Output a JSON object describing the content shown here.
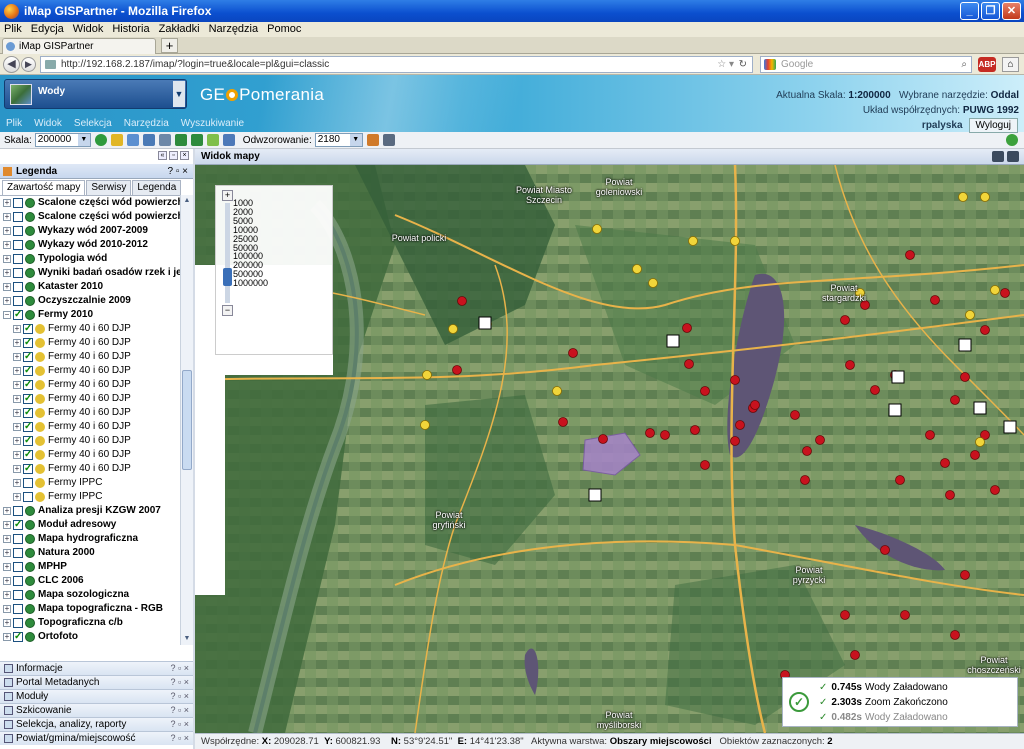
{
  "browser": {
    "title": "iMap GISPartner - Mozilla Firefox",
    "menu": [
      "Plik",
      "Edycja",
      "Widok",
      "Historia",
      "Zakładki",
      "Narzędzia",
      "Pomoc"
    ],
    "tab_title": "iMap GISPartner",
    "new_tab": "+",
    "url": "http://192.168.2.187/imap/?login=true&locale=pl&gui=classic",
    "search_placeholder": "Google",
    "addon_label": "ABP"
  },
  "app": {
    "active_layer": "Wody",
    "logo_pre": "GE",
    "logo_post": "Pomerania",
    "menu": [
      "Plik",
      "Widok",
      "Selekcja",
      "Narzędzia",
      "Wyszukiwanie"
    ],
    "scale_label": "Aktualna Skala:",
    "scale_value": "1:200000",
    "tool_label": "Wybrane narzędzie:",
    "tool_value": "Oddal",
    "crs_label": "Układ współrzędnych:",
    "crs_value": "PUWG 1992",
    "user": "rpalyska",
    "logout": "Wyloguj"
  },
  "toolbar": {
    "scale_label": "Skala:",
    "scale_value": "200000",
    "refresh_label": "Odwzorowanie:",
    "refresh_value": "2180"
  },
  "legend": {
    "title": "Legenda",
    "tabs": [
      "Zawartość mapy",
      "Serwisy",
      "Legenda"
    ],
    "items": [
      {
        "label": "Scalone części wód powierzchn",
        "lvl": 0,
        "bold": true,
        "checked": false,
        "exp": "+"
      },
      {
        "label": "Scalone części wód powierzchn",
        "lvl": 0,
        "bold": true,
        "checked": false,
        "exp": "+"
      },
      {
        "label": "Wykazy wód 2007-2009",
        "lvl": 0,
        "bold": true,
        "checked": false,
        "exp": "+"
      },
      {
        "label": "Wykazy wód 2010-2012",
        "lvl": 0,
        "bold": true,
        "checked": false,
        "exp": "+"
      },
      {
        "label": "Typologia wód",
        "lvl": 0,
        "bold": true,
        "checked": false,
        "exp": "+"
      },
      {
        "label": "Wyniki badań osadów rzek i jez",
        "lvl": 0,
        "bold": true,
        "checked": false,
        "exp": "+"
      },
      {
        "label": "Kataster 2010",
        "lvl": 0,
        "bold": true,
        "checked": false,
        "exp": "+"
      },
      {
        "label": "Oczyszczalnie 2009",
        "lvl": 0,
        "bold": true,
        "checked": false,
        "exp": "+"
      },
      {
        "label": "Fermy 2010",
        "lvl": 0,
        "bold": true,
        "checked": true,
        "exp": "−"
      },
      {
        "label": "Fermy 40 i 60 DJP",
        "lvl": 1,
        "bold": false,
        "checked": true,
        "exp": "+"
      },
      {
        "label": "Fermy 40 i 60 DJP",
        "lvl": 1,
        "bold": false,
        "checked": true,
        "exp": "+"
      },
      {
        "label": "Fermy 40 i 60 DJP",
        "lvl": 1,
        "bold": false,
        "checked": true,
        "exp": "+"
      },
      {
        "label": "Fermy 40 i 60 DJP",
        "lvl": 1,
        "bold": false,
        "checked": true,
        "exp": "+"
      },
      {
        "label": "Fermy 40 i 60 DJP",
        "lvl": 1,
        "bold": false,
        "checked": true,
        "exp": "+"
      },
      {
        "label": "Fermy 40 i 60 DJP",
        "lvl": 1,
        "bold": false,
        "checked": true,
        "exp": "+"
      },
      {
        "label": "Fermy 40 i 60 DJP",
        "lvl": 1,
        "bold": false,
        "checked": true,
        "exp": "+"
      },
      {
        "label": "Fermy 40 i 60 DJP",
        "lvl": 1,
        "bold": false,
        "checked": true,
        "exp": "+"
      },
      {
        "label": "Fermy 40 i 60 DJP",
        "lvl": 1,
        "bold": false,
        "checked": true,
        "exp": "+"
      },
      {
        "label": "Fermy 40 i 60 DJP",
        "lvl": 1,
        "bold": false,
        "checked": true,
        "exp": "+"
      },
      {
        "label": "Fermy 40 i 60 DJP",
        "lvl": 1,
        "bold": false,
        "checked": true,
        "exp": "+"
      },
      {
        "label": "Fermy IPPC",
        "lvl": 1,
        "bold": false,
        "checked": false,
        "exp": "+"
      },
      {
        "label": "Fermy IPPC",
        "lvl": 1,
        "bold": false,
        "checked": false,
        "exp": "+"
      },
      {
        "label": "Analiza presji KZGW 2007",
        "lvl": 0,
        "bold": true,
        "checked": false,
        "exp": "+"
      },
      {
        "label": "Moduł adresowy",
        "lvl": 0,
        "bold": true,
        "checked": true,
        "exp": "+"
      },
      {
        "label": "Mapa hydrograficzna",
        "lvl": 0,
        "bold": true,
        "checked": false,
        "exp": "+"
      },
      {
        "label": "Natura 2000",
        "lvl": 0,
        "bold": true,
        "checked": false,
        "exp": "+"
      },
      {
        "label": "MPHP",
        "lvl": 0,
        "bold": true,
        "checked": false,
        "exp": "+"
      },
      {
        "label": "CLC 2006",
        "lvl": 0,
        "bold": true,
        "checked": false,
        "exp": "+"
      },
      {
        "label": "Mapa sozologiczna",
        "lvl": 0,
        "bold": true,
        "checked": false,
        "exp": "+"
      },
      {
        "label": "Mapa topograficzna - RGB",
        "lvl": 0,
        "bold": true,
        "checked": false,
        "exp": "+"
      },
      {
        "label": "Topograficzna c/b",
        "lvl": 0,
        "bold": true,
        "checked": false,
        "exp": "+"
      },
      {
        "label": "Ortofoto",
        "lvl": 0,
        "bold": true,
        "checked": true,
        "exp": "+"
      }
    ]
  },
  "accordion": [
    "Informacje",
    "Portal Metadanych",
    "Moduły",
    "Szkicowanie",
    "Selekcja, analizy, raporty",
    "Powiat/gmina/miejscowość"
  ],
  "map": {
    "title": "Widok mapy",
    "zoom_levels": [
      "1000",
      "2000",
      "5000",
      "10000",
      "25000",
      "50000",
      "100000",
      "200000",
      "500000",
      "1000000"
    ],
    "status": [
      {
        "time": "0.745s",
        "layer": "Wody",
        "msg": "Załadowano"
      },
      {
        "time": "2.303s",
        "layer": "Zoom",
        "msg": "Zakończono"
      },
      {
        "time": "0.482s",
        "layer": "Wody",
        "msg": "Załadowano"
      }
    ],
    "place_labels": [
      "Powiat Miasto Szczecin",
      "Powiat goleniowski",
      "Powiat policki",
      "Powiat stargardzki",
      "Powiat gryfiński",
      "Powiat pyrzycki",
      "Powiat myśliborski",
      "Powiat choszczeński"
    ]
  },
  "statusbar": {
    "coord_label": "Współrzędne:",
    "x_label": "X:",
    "x": "209028.71",
    "y_label": "Y:",
    "y": "600821.93",
    "n_label": "N:",
    "n": "53°9'24.51\"",
    "e_label": "E:",
    "e": "14°41'23.38\"",
    "active_label": "Aktywna warstwa:",
    "active": "Obszary miejscowości",
    "selected_label": "Obiektów zaznaczonych:",
    "selected": "2"
  }
}
